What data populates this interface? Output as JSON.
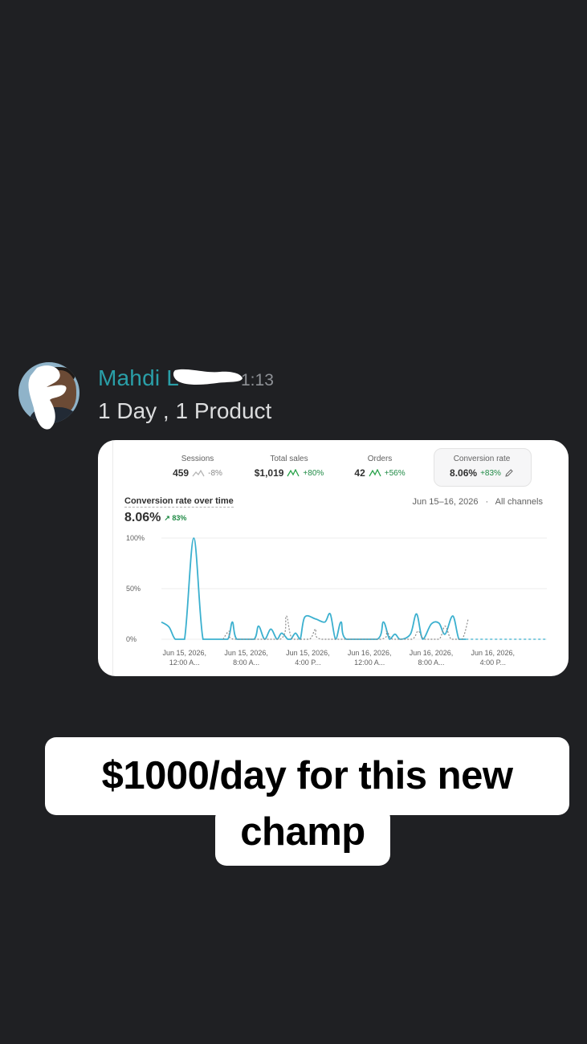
{
  "post": {
    "username": "Mahdi L",
    "timestamp": "1:13",
    "message": "1 Day , 1 Product"
  },
  "metrics": [
    {
      "label": "Sessions",
      "value": "459",
      "delta": "-8%",
      "trend": "neg"
    },
    {
      "label": "Total sales",
      "value": "$1,019",
      "delta": "+80%",
      "trend": "pos"
    },
    {
      "label": "Orders",
      "value": "42",
      "delta": "+56%",
      "trend": "pos"
    },
    {
      "label": "Conversion rate",
      "value": "8.06%",
      "delta": "+83%",
      "trend": "pos",
      "active": true
    }
  ],
  "chart_header": {
    "title": "Conversion rate over time",
    "value": "8.06%",
    "delta": "83%",
    "date_range": "Jun 15–16, 2026",
    "separator": "·",
    "channels": "All channels"
  },
  "chart_data": {
    "type": "line",
    "title": "Conversion rate over time",
    "ylim": [
      0,
      100
    ],
    "y_ticks": [
      "100%",
      "50%",
      "0%"
    ],
    "y_tick_values": [
      100,
      50,
      0
    ],
    "x_tick_labels": [
      [
        "Jun 15, 2026,",
        "12:00 A..."
      ],
      [
        "Jun 15, 2026,",
        "8:00 A..."
      ],
      [
        "Jun 15, 2026,",
        "4:00 P..."
      ],
      [
        "Jun 16, 2026,",
        "12:00 A..."
      ],
      [
        "Jun 16, 2026,",
        "8:00 A..."
      ],
      [
        "Jun 16, 2026,",
        "4:00 P..."
      ]
    ],
    "x_tick_hours": [
      0,
      8,
      16,
      24,
      32,
      40
    ],
    "x_range_hours": [
      -3,
      47
    ],
    "series": [
      {
        "style": "solid",
        "color": "#3bb0cf",
        "points": [
          [
            -3,
            17
          ],
          [
            -2,
            12
          ],
          [
            -1.2,
            0
          ],
          [
            0,
            0
          ],
          [
            1.2,
            100
          ],
          [
            2.4,
            0
          ],
          [
            4,
            0
          ],
          [
            5.6,
            0
          ],
          [
            6.2,
            17
          ],
          [
            6.8,
            0
          ],
          [
            9,
            0
          ],
          [
            9.6,
            13
          ],
          [
            10.4,
            0
          ],
          [
            11.2,
            10
          ],
          [
            12,
            0
          ],
          [
            12.6,
            6
          ],
          [
            13.4,
            0
          ],
          [
            13.8,
            0
          ],
          [
            14.4,
            6
          ],
          [
            15,
            0
          ],
          [
            15.6,
            22
          ],
          [
            17,
            20
          ],
          [
            18.2,
            17
          ],
          [
            18.9,
            25
          ],
          [
            19.6,
            0
          ],
          [
            20.3,
            17
          ],
          [
            21,
            0
          ],
          [
            25,
            0
          ],
          [
            25.8,
            17
          ],
          [
            26.6,
            0
          ],
          [
            27.3,
            5
          ],
          [
            28,
            0
          ],
          [
            29.3,
            5
          ],
          [
            30.1,
            25
          ],
          [
            30.9,
            0
          ],
          [
            32,
            15
          ],
          [
            33,
            16
          ],
          [
            33.8,
            5
          ],
          [
            34.8,
            23
          ],
          [
            35.6,
            0
          ],
          [
            36.5,
            0
          ]
        ]
      },
      {
        "style": "dashed",
        "color": "#8a8a8a",
        "points": [
          [
            5,
            0
          ],
          [
            5.8,
            8
          ],
          [
            6.4,
            0
          ],
          [
            12.4,
            0
          ],
          [
            13.2,
            23
          ],
          [
            14,
            0
          ],
          [
            16.2,
            0
          ],
          [
            17,
            10
          ],
          [
            17.8,
            0
          ],
          [
            25.4,
            0
          ],
          [
            26.2,
            8
          ],
          [
            27,
            0
          ],
          [
            29.5,
            0
          ],
          [
            30.3,
            8
          ],
          [
            31.1,
            0
          ],
          [
            33,
            0
          ],
          [
            33.8,
            13
          ],
          [
            34.6,
            0
          ],
          [
            36,
            0
          ],
          [
            36.8,
            20
          ]
        ]
      }
    ]
  },
  "caption": {
    "line1": "$1000/day for this new",
    "line2": "champ"
  },
  "colors": {
    "background": "#1f2023",
    "username": "#2a9fa8",
    "accent_line": "#3bb0cf",
    "positive": "#1f8a45"
  }
}
